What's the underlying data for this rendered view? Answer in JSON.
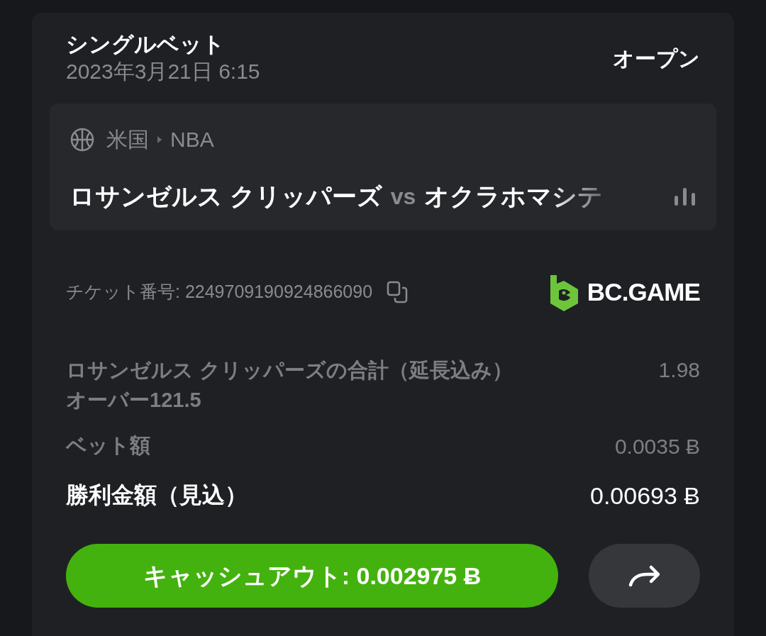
{
  "header": {
    "title": "シングルベット",
    "datetime": "2023年3月21日 6:15",
    "status": "オープン"
  },
  "match": {
    "country": "米国",
    "league": "NBA",
    "home": "ロサンゼルス クリッパーズ",
    "vs": "vs",
    "away": "オクラホマシテ"
  },
  "ticket": {
    "label": "チケット番号: 2249709190924866090",
    "brand": "BC.GAME"
  },
  "selection": {
    "market": "ロサンゼルス クリッパーズの合計（延長込み）",
    "pick": "オーバー121.5",
    "odds": "1.98"
  },
  "stake": {
    "label": "ベット額",
    "value": "0.0035 Ƀ"
  },
  "payout": {
    "label": "勝利金額（見込）",
    "value": "0.00693 Ƀ"
  },
  "cashout": {
    "label": "キャッシュアウト: 0.002975 Ƀ"
  }
}
